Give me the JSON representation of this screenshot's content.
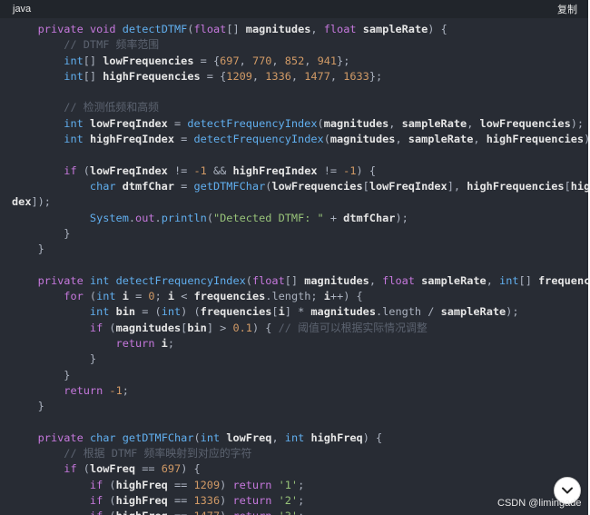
{
  "header": {
    "language": "java",
    "copy_label": "复制"
  },
  "code_lines": [
    [
      {
        "t": "    "
      },
      {
        "c": "kw",
        "t": "private"
      },
      {
        "t": " "
      },
      {
        "c": "kw",
        "t": "void"
      },
      {
        "t": " "
      },
      {
        "c": "fn",
        "t": "detectDTMF"
      },
      {
        "c": "pl",
        "t": "("
      },
      {
        "c": "kw",
        "t": "float"
      },
      {
        "c": "pl",
        "t": "[] "
      },
      {
        "c": "id",
        "t": "magnitudes"
      },
      {
        "c": "pl",
        "t": ", "
      },
      {
        "c": "kw",
        "t": "float"
      },
      {
        "t": " "
      },
      {
        "c": "id",
        "t": "sampleRate"
      },
      {
        "c": "pl",
        "t": ") {"
      }
    ],
    [
      {
        "t": "        "
      },
      {
        "c": "cm",
        "t": "// DTMF 频率范围"
      }
    ],
    [
      {
        "t": "        "
      },
      {
        "c": "ty",
        "t": "int"
      },
      {
        "c": "pl",
        "t": "[] "
      },
      {
        "c": "id",
        "t": "lowFrequencies"
      },
      {
        "c": "pl",
        "t": " = {"
      },
      {
        "c": "nm",
        "t": "697"
      },
      {
        "c": "pl",
        "t": ", "
      },
      {
        "c": "nm",
        "t": "770"
      },
      {
        "c": "pl",
        "t": ", "
      },
      {
        "c": "nm",
        "t": "852"
      },
      {
        "c": "pl",
        "t": ", "
      },
      {
        "c": "nm",
        "t": "941"
      },
      {
        "c": "pl",
        "t": "};"
      }
    ],
    [
      {
        "t": "        "
      },
      {
        "c": "ty",
        "t": "int"
      },
      {
        "c": "pl",
        "t": "[] "
      },
      {
        "c": "id",
        "t": "highFrequencies"
      },
      {
        "c": "pl",
        "t": " = {"
      },
      {
        "c": "nm",
        "t": "1209"
      },
      {
        "c": "pl",
        "t": ", "
      },
      {
        "c": "nm",
        "t": "1336"
      },
      {
        "c": "pl",
        "t": ", "
      },
      {
        "c": "nm",
        "t": "1477"
      },
      {
        "c": "pl",
        "t": ", "
      },
      {
        "c": "nm",
        "t": "1633"
      },
      {
        "c": "pl",
        "t": "};"
      }
    ],
    [
      {
        "t": ""
      }
    ],
    [
      {
        "t": "        "
      },
      {
        "c": "cm",
        "t": "// 检测低频和高频"
      }
    ],
    [
      {
        "t": "        "
      },
      {
        "c": "ty",
        "t": "int"
      },
      {
        "t": " "
      },
      {
        "c": "id",
        "t": "lowFreqIndex"
      },
      {
        "c": "pl",
        "t": " = "
      },
      {
        "c": "fn",
        "t": "detectFrequencyIndex"
      },
      {
        "c": "pl",
        "t": "("
      },
      {
        "c": "id",
        "t": "magnitudes"
      },
      {
        "c": "pl",
        "t": ", "
      },
      {
        "c": "id",
        "t": "sampleRate"
      },
      {
        "c": "pl",
        "t": ", "
      },
      {
        "c": "id",
        "t": "lowFrequencies"
      },
      {
        "c": "pl",
        "t": ");"
      }
    ],
    [
      {
        "t": "        "
      },
      {
        "c": "ty",
        "t": "int"
      },
      {
        "t": " "
      },
      {
        "c": "id",
        "t": "highFreqIndex"
      },
      {
        "c": "pl",
        "t": " = "
      },
      {
        "c": "fn",
        "t": "detectFrequencyIndex"
      },
      {
        "c": "pl",
        "t": "("
      },
      {
        "c": "id",
        "t": "magnitudes"
      },
      {
        "c": "pl",
        "t": ", "
      },
      {
        "c": "id",
        "t": "sampleRate"
      },
      {
        "c": "pl",
        "t": ", "
      },
      {
        "c": "id",
        "t": "highFrequencies"
      },
      {
        "c": "pl",
        "t": ");"
      }
    ],
    [
      {
        "t": ""
      }
    ],
    [
      {
        "t": "        "
      },
      {
        "c": "kw",
        "t": "if"
      },
      {
        "c": "pl",
        "t": " ("
      },
      {
        "c": "id",
        "t": "lowFreqIndex"
      },
      {
        "c": "pl",
        "t": " != "
      },
      {
        "c": "nm",
        "t": "-1"
      },
      {
        "c": "pl",
        "t": " && "
      },
      {
        "c": "id",
        "t": "highFreqIndex"
      },
      {
        "c": "pl",
        "t": " != "
      },
      {
        "c": "nm",
        "t": "-1"
      },
      {
        "c": "pl",
        "t": ") {"
      }
    ],
    [
      {
        "t": "            "
      },
      {
        "c": "ty",
        "t": "char"
      },
      {
        "t": " "
      },
      {
        "c": "id",
        "t": "dtmfChar"
      },
      {
        "c": "pl",
        "t": " = "
      },
      {
        "c": "fn",
        "t": "getDTMFChar"
      },
      {
        "c": "pl",
        "t": "("
      },
      {
        "c": "id",
        "t": "lowFrequencies"
      },
      {
        "c": "pl",
        "t": "["
      },
      {
        "c": "id",
        "t": "lowFreqIndex"
      },
      {
        "c": "pl",
        "t": "], "
      },
      {
        "c": "id",
        "t": "highFrequencies"
      },
      {
        "c": "pl",
        "t": "["
      },
      {
        "c": "id",
        "t": "highFreqIn"
      }
    ],
    [
      {
        "c": "id",
        "t": "dex"
      },
      {
        "c": "pl",
        "t": "]);"
      }
    ],
    [
      {
        "t": "            "
      },
      {
        "c": "ty",
        "t": "System"
      },
      {
        "c": "pl",
        "t": "."
      },
      {
        "c": "kw",
        "t": "out"
      },
      {
        "c": "pl",
        "t": "."
      },
      {
        "c": "fn",
        "t": "println"
      },
      {
        "c": "pl",
        "t": "("
      },
      {
        "c": "str",
        "t": "\"Detected DTMF: \""
      },
      {
        "c": "pl",
        "t": " + "
      },
      {
        "c": "id",
        "t": "dtmfChar"
      },
      {
        "c": "pl",
        "t": ");"
      }
    ],
    [
      {
        "t": "        "
      },
      {
        "c": "pl",
        "t": "}"
      }
    ],
    [
      {
        "t": "    "
      },
      {
        "c": "pl",
        "t": "}"
      }
    ],
    [
      {
        "t": ""
      }
    ],
    [
      {
        "t": "    "
      },
      {
        "c": "kw",
        "t": "private"
      },
      {
        "t": " "
      },
      {
        "c": "ty",
        "t": "int"
      },
      {
        "t": " "
      },
      {
        "c": "fn",
        "t": "detectFrequencyIndex"
      },
      {
        "c": "pl",
        "t": "("
      },
      {
        "c": "kw",
        "t": "float"
      },
      {
        "c": "pl",
        "t": "[] "
      },
      {
        "c": "id",
        "t": "magnitudes"
      },
      {
        "c": "pl",
        "t": ", "
      },
      {
        "c": "kw",
        "t": "float"
      },
      {
        "t": " "
      },
      {
        "c": "id",
        "t": "sampleRate"
      },
      {
        "c": "pl",
        "t": ", "
      },
      {
        "c": "ty",
        "t": "int"
      },
      {
        "c": "pl",
        "t": "[] "
      },
      {
        "c": "id",
        "t": "frequencies"
      },
      {
        "c": "pl",
        "t": ") {"
      }
    ],
    [
      {
        "t": "        "
      },
      {
        "c": "kw",
        "t": "for"
      },
      {
        "c": "pl",
        "t": " ("
      },
      {
        "c": "ty",
        "t": "int"
      },
      {
        "t": " "
      },
      {
        "c": "id",
        "t": "i"
      },
      {
        "c": "pl",
        "t": " = "
      },
      {
        "c": "nm",
        "t": "0"
      },
      {
        "c": "pl",
        "t": "; "
      },
      {
        "c": "id",
        "t": "i"
      },
      {
        "c": "pl",
        "t": " < "
      },
      {
        "c": "id",
        "t": "frequencies"
      },
      {
        "c": "pl",
        "t": ".length; "
      },
      {
        "c": "id",
        "t": "i"
      },
      {
        "c": "pl",
        "t": "++) {"
      }
    ],
    [
      {
        "t": "            "
      },
      {
        "c": "ty",
        "t": "int"
      },
      {
        "t": " "
      },
      {
        "c": "id",
        "t": "bin"
      },
      {
        "c": "pl",
        "t": " = ("
      },
      {
        "c": "ty",
        "t": "int"
      },
      {
        "c": "pl",
        "t": ") ("
      },
      {
        "c": "id",
        "t": "frequencies"
      },
      {
        "c": "pl",
        "t": "["
      },
      {
        "c": "id",
        "t": "i"
      },
      {
        "c": "pl",
        "t": "] * "
      },
      {
        "c": "id",
        "t": "magnitudes"
      },
      {
        "c": "pl",
        "t": ".length / "
      },
      {
        "c": "id",
        "t": "sampleRate"
      },
      {
        "c": "pl",
        "t": ");"
      }
    ],
    [
      {
        "t": "            "
      },
      {
        "c": "kw",
        "t": "if"
      },
      {
        "c": "pl",
        "t": " ("
      },
      {
        "c": "id",
        "t": "magnitudes"
      },
      {
        "c": "pl",
        "t": "["
      },
      {
        "c": "id",
        "t": "bin"
      },
      {
        "c": "pl",
        "t": "] > "
      },
      {
        "c": "nm",
        "t": "0.1"
      },
      {
        "c": "pl",
        "t": ") { "
      },
      {
        "c": "cm",
        "t": "// 阈值可以根据实际情况调整"
      }
    ],
    [
      {
        "t": "                "
      },
      {
        "c": "kw",
        "t": "return"
      },
      {
        "t": " "
      },
      {
        "c": "id",
        "t": "i"
      },
      {
        "c": "pl",
        "t": ";"
      }
    ],
    [
      {
        "t": "            "
      },
      {
        "c": "pl",
        "t": "}"
      }
    ],
    [
      {
        "t": "        "
      },
      {
        "c": "pl",
        "t": "}"
      }
    ],
    [
      {
        "t": "        "
      },
      {
        "c": "kw",
        "t": "return"
      },
      {
        "t": " "
      },
      {
        "c": "nm",
        "t": "-1"
      },
      {
        "c": "pl",
        "t": ";"
      }
    ],
    [
      {
        "t": "    "
      },
      {
        "c": "pl",
        "t": "}"
      }
    ],
    [
      {
        "t": ""
      }
    ],
    [
      {
        "t": "    "
      },
      {
        "c": "kw",
        "t": "private"
      },
      {
        "t": " "
      },
      {
        "c": "ty",
        "t": "char"
      },
      {
        "t": " "
      },
      {
        "c": "fn",
        "t": "getDTMFChar"
      },
      {
        "c": "pl",
        "t": "("
      },
      {
        "c": "ty",
        "t": "int"
      },
      {
        "t": " "
      },
      {
        "c": "id",
        "t": "lowFreq"
      },
      {
        "c": "pl",
        "t": ", "
      },
      {
        "c": "ty",
        "t": "int"
      },
      {
        "t": " "
      },
      {
        "c": "id",
        "t": "highFreq"
      },
      {
        "c": "pl",
        "t": ") {"
      }
    ],
    [
      {
        "t": "        "
      },
      {
        "c": "cm",
        "t": "// 根据 DTMF 频率映射到对应的字符"
      }
    ],
    [
      {
        "t": "        "
      },
      {
        "c": "kw",
        "t": "if"
      },
      {
        "c": "pl",
        "t": " ("
      },
      {
        "c": "id",
        "t": "lowFreq"
      },
      {
        "c": "pl",
        "t": " == "
      },
      {
        "c": "nm",
        "t": "697"
      },
      {
        "c": "pl",
        "t": ") {"
      }
    ],
    [
      {
        "t": "            "
      },
      {
        "c": "kw",
        "t": "if"
      },
      {
        "c": "pl",
        "t": " ("
      },
      {
        "c": "id",
        "t": "highFreq"
      },
      {
        "c": "pl",
        "t": " == "
      },
      {
        "c": "nm",
        "t": "1209"
      },
      {
        "c": "pl",
        "t": ") "
      },
      {
        "c": "kw",
        "t": "return"
      },
      {
        "t": " "
      },
      {
        "c": "str",
        "t": "'1'"
      },
      {
        "c": "pl",
        "t": ";"
      }
    ],
    [
      {
        "t": "            "
      },
      {
        "c": "kw",
        "t": "if"
      },
      {
        "c": "pl",
        "t": " ("
      },
      {
        "c": "id",
        "t": "highFreq"
      },
      {
        "c": "pl",
        "t": " == "
      },
      {
        "c": "nm",
        "t": "1336"
      },
      {
        "c": "pl",
        "t": ") "
      },
      {
        "c": "kw",
        "t": "return"
      },
      {
        "t": " "
      },
      {
        "c": "str",
        "t": "'2'"
      },
      {
        "c": "pl",
        "t": ";"
      }
    ],
    [
      {
        "t": "            "
      },
      {
        "c": "kw",
        "t": "if"
      },
      {
        "c": "pl",
        "t": " ("
      },
      {
        "c": "id",
        "t": "highFreq"
      },
      {
        "c": "pl",
        "t": " == "
      },
      {
        "c": "nm",
        "t": "1477"
      },
      {
        "c": "pl",
        "t": ") "
      },
      {
        "c": "kw",
        "t": "return"
      },
      {
        "t": " "
      },
      {
        "c": "str",
        "t": "'3'"
      },
      {
        "c": "pl",
        "t": ";"
      }
    ]
  ],
  "watermark": "CSDN @limingade",
  "scroll_icon": "chevron-down-icon",
  "colors": {
    "background": "#282c34",
    "header": "#21252b",
    "keyword": "#c678dd",
    "type": "#61afef",
    "number": "#d19a66",
    "string": "#98c379",
    "comment": "#5c6370"
  }
}
